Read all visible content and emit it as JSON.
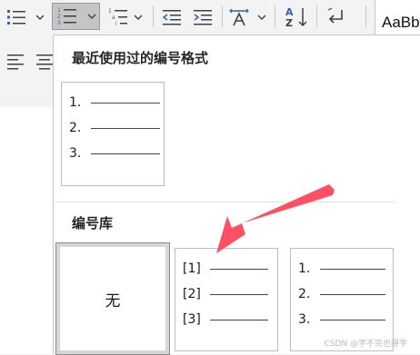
{
  "ribbon": {
    "styles_preview": "AaBb"
  },
  "dropdown": {
    "recent_title": "最近使用过的编号格式",
    "library_title": "编号库",
    "recent": {
      "rows": [
        {
          "num": "1."
        },
        {
          "num": "2."
        },
        {
          "num": "3."
        }
      ]
    },
    "library": [
      {
        "kind": "none",
        "label": "无"
      },
      {
        "kind": "list",
        "rows": [
          {
            "num": "[1]"
          },
          {
            "num": "[2]"
          },
          {
            "num": "[3]"
          }
        ]
      },
      {
        "kind": "list",
        "rows": [
          {
            "num": "1."
          },
          {
            "num": "2."
          },
          {
            "num": "3."
          }
        ]
      }
    ]
  },
  "annotation": {
    "arrow_color": "#ff4f62"
  },
  "watermark": "CSDN @学不完也得学"
}
